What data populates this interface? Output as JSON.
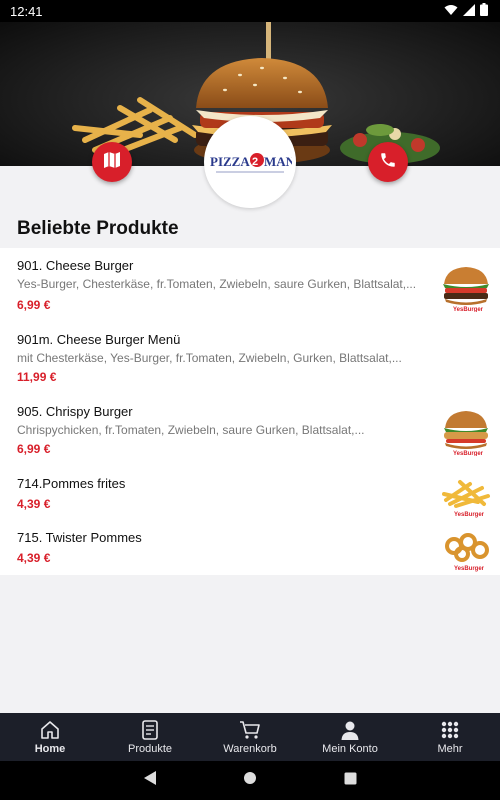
{
  "status_bar": {
    "time": "12:41"
  },
  "hero": {
    "logo_text": "PIZZA MAN"
  },
  "section": {
    "title": "Beliebte Produkte"
  },
  "products": [
    {
      "name": "901. Cheese Burger",
      "description": "Yes-Burger, Chesterkäse, fr.Tomaten, Zwiebeln, saure Gurken, Blattsalat,...",
      "price": "6,99 €",
      "image": "cheeseburger-image"
    },
    {
      "name": "901m. Cheese Burger Menü",
      "description": "mit Chesterkäse, Yes-Burger, fr.Tomaten, Zwiebeln, Gurken, Blattsalat,...",
      "price": "11,99 €",
      "image": ""
    },
    {
      "name": "905. Chrispy Burger",
      "description": "Chrispychicken, fr.Tomaten, Zwiebeln, saure Gurken, Blattsalat,...",
      "price": "6,99 €",
      "image": "chicken-burger-image"
    },
    {
      "name": "714.Pommes frites",
      "description": "",
      "price": "4,39 €",
      "image": "french-fries-image"
    },
    {
      "name": "715. Twister Pommes",
      "description": "",
      "price": "4,39 €",
      "image": "twister-fries-image"
    }
  ],
  "nav": {
    "items": [
      {
        "label": "Home",
        "icon": "home-icon",
        "active": true
      },
      {
        "label": "Produkte",
        "icon": "menu-book-icon",
        "active": false
      },
      {
        "label": "Warenkorb",
        "icon": "cart-icon",
        "active": false
      },
      {
        "label": "Mein Konto",
        "icon": "person-icon",
        "active": false
      },
      {
        "label": "Mehr",
        "icon": "grid-dots-icon",
        "active": false
      }
    ]
  },
  "colors": {
    "accent": "#d81f2a",
    "nav_bg": "#1c1f29",
    "price": "#d81f2a"
  }
}
